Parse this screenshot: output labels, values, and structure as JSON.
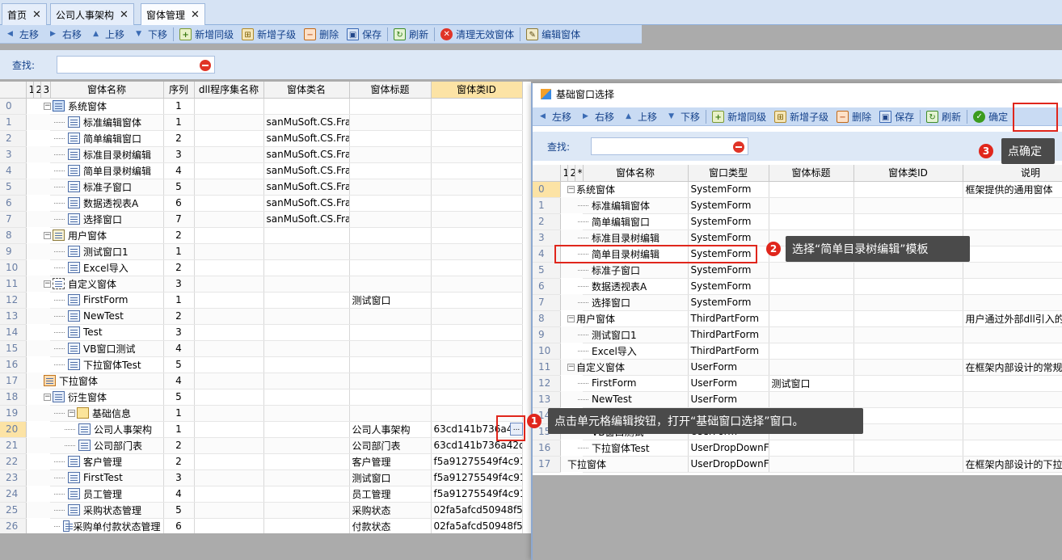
{
  "tabs": [
    {
      "label": "首页"
    },
    {
      "label": "公司人事架构"
    },
    {
      "label": "窗体管理",
      "active": true
    }
  ],
  "toolbar": {
    "left": "左移",
    "right": "右移",
    "up": "上移",
    "down": "下移",
    "add_sibling": "新增同级",
    "add_child": "新增子级",
    "delete": "删除",
    "save": "保存",
    "refresh": "刷新",
    "clear_invalid": "清理无效窗体",
    "edit_form": "编辑窗体"
  },
  "search": {
    "label": "查找:",
    "value": ""
  },
  "main_grid": {
    "headers": {
      "levels": [
        "1",
        "2",
        "3",
        "*"
      ],
      "name": "窗体名称",
      "seq": "序列",
      "dll": "dll程序集名称",
      "class": "窗体类名",
      "title": "窗体标题",
      "typeid": "窗体类ID"
    },
    "rows": [
      {
        "n": "0",
        "name": "系统窗体",
        "seq": "1",
        "cls": "",
        "title": "",
        "id": "",
        "lvl": 0,
        "icon": "sys",
        "exp": "⊟"
      },
      {
        "n": "1",
        "name": "标准编辑窗体",
        "seq": "1",
        "cls": "sanMuSoft.CS.Fra",
        "title": "",
        "id": "",
        "lvl": 1,
        "icon": "form"
      },
      {
        "n": "2",
        "name": "简单编辑窗口",
        "seq": "2",
        "cls": "sanMuSoft.CS.Fra",
        "title": "",
        "id": "",
        "lvl": 1,
        "icon": "form"
      },
      {
        "n": "3",
        "name": "标准目录树编辑",
        "seq": "3",
        "cls": "sanMuSoft.CS.Fra",
        "title": "",
        "id": "",
        "lvl": 1,
        "icon": "form"
      },
      {
        "n": "4",
        "name": "简单目录树编辑",
        "seq": "4",
        "cls": "sanMuSoft.CS.Fra",
        "title": "",
        "id": "",
        "lvl": 1,
        "icon": "form"
      },
      {
        "n": "5",
        "name": "标准子窗口",
        "seq": "5",
        "cls": "sanMuSoft.CS.Fra",
        "title": "",
        "id": "",
        "lvl": 1,
        "icon": "form"
      },
      {
        "n": "6",
        "name": "数据透视表A",
        "seq": "6",
        "cls": "sanMuSoft.CS.Fra",
        "title": "",
        "id": "",
        "lvl": 1,
        "icon": "form"
      },
      {
        "n": "7",
        "name": "选择窗口",
        "seq": "7",
        "cls": "sanMuSoft.CS.Fra",
        "title": "",
        "id": "",
        "lvl": 1,
        "icon": "form"
      },
      {
        "n": "8",
        "name": "用户窗体",
        "seq": "2",
        "cls": "",
        "title": "",
        "id": "",
        "lvl": 0,
        "icon": "usr",
        "exp": "⊟"
      },
      {
        "n": "9",
        "name": "测试窗口1",
        "seq": "1",
        "cls": "",
        "title": "",
        "id": "",
        "lvl": 1,
        "icon": "form"
      },
      {
        "n": "10",
        "name": "Excel导入",
        "seq": "2",
        "cls": "",
        "title": "",
        "id": "",
        "lvl": 1,
        "icon": "form"
      },
      {
        "n": "11",
        "name": "自定义窗体",
        "seq": "3",
        "cls": "",
        "title": "",
        "id": "",
        "lvl": 0,
        "icon": "custom",
        "exp": "⊟"
      },
      {
        "n": "12",
        "name": "FirstForm",
        "seq": "1",
        "cls": "",
        "title": "测试窗口",
        "id": "",
        "lvl": 1,
        "icon": "form"
      },
      {
        "n": "13",
        "name": "NewTest",
        "seq": "2",
        "cls": "",
        "title": "",
        "id": "",
        "lvl": 1,
        "icon": "form"
      },
      {
        "n": "14",
        "name": "Test",
        "seq": "3",
        "cls": "",
        "title": "",
        "id": "",
        "lvl": 1,
        "icon": "form"
      },
      {
        "n": "15",
        "name": "VB窗口测试",
        "seq": "4",
        "cls": "",
        "title": "",
        "id": "",
        "lvl": 1,
        "icon": "form"
      },
      {
        "n": "16",
        "name": "下拉窗体Test",
        "seq": "5",
        "cls": "",
        "title": "",
        "id": "",
        "lvl": 1,
        "icon": "form"
      },
      {
        "n": "17",
        "name": "下拉窗体",
        "seq": "4",
        "cls": "",
        "title": "",
        "id": "",
        "lvl": 0,
        "icon": "drop",
        "exp": ""
      },
      {
        "n": "18",
        "name": "衍生窗体",
        "seq": "5",
        "cls": "",
        "title": "",
        "id": "",
        "lvl": 0,
        "icon": "derive",
        "exp": "⊟"
      },
      {
        "n": "19",
        "name": "基础信息",
        "seq": "1",
        "cls": "",
        "title": "",
        "id": "",
        "lvl": 1,
        "icon": "folder",
        "exp": "⊟"
      },
      {
        "n": "20",
        "name": "公司人事架构",
        "seq": "1",
        "cls": "",
        "title": "公司人事架构",
        "id": "63cd141b736a4",
        "lvl": 2,
        "icon": "form",
        "selected": true
      },
      {
        "n": "21",
        "name": "公司部门表",
        "seq": "2",
        "cls": "",
        "title": "公司部门表",
        "id": "63cd141b736a42d",
        "lvl": 2,
        "icon": "form"
      },
      {
        "n": "22",
        "name": "客户管理",
        "seq": "2",
        "cls": "",
        "title": "客户管理",
        "id": "f5a91275549f4c91a",
        "lvl": 1,
        "icon": "form"
      },
      {
        "n": "23",
        "name": "FirstTest",
        "seq": "3",
        "cls": "",
        "title": "测试窗口",
        "id": "f5a91275549f4c91a",
        "lvl": 1,
        "icon": "form"
      },
      {
        "n": "24",
        "name": "员工管理",
        "seq": "4",
        "cls": "",
        "title": "员工管理",
        "id": "f5a91275549f4c91a",
        "lvl": 1,
        "icon": "form"
      },
      {
        "n": "25",
        "name": "采购状态管理",
        "seq": "5",
        "cls": "",
        "title": "采购状态",
        "id": "02fa5afcd50948f59",
        "lvl": 1,
        "icon": "form"
      },
      {
        "n": "26",
        "name": "采购单付款状态管理",
        "seq": "6",
        "cls": "",
        "title": "付款状态",
        "id": "02fa5afcd50948f59",
        "lvl": 1,
        "icon": "form"
      }
    ]
  },
  "dialog": {
    "title": "基础窗口选择",
    "toolbar": {
      "left": "左移",
      "right": "右移",
      "up": "上移",
      "down": "下移",
      "add_sibling": "新增同级",
      "add_child": "新增子级",
      "delete": "删除",
      "save": "保存",
      "refresh": "刷新",
      "ok": "确定"
    },
    "search_label": "查找:",
    "headers": {
      "levels": [
        "1",
        "2",
        "*"
      ],
      "name": "窗体名称",
      "wtype": "窗口类型",
      "title": "窗体标题",
      "typeid": "窗体类ID",
      "desc": "说明"
    },
    "rows": [
      {
        "n": "0",
        "name": "系统窗体",
        "wtype": "SystemForm",
        "title": "",
        "desc": "框架提供的通用窗体",
        "lvl": 0,
        "exp": "⊟"
      },
      {
        "n": "1",
        "name": "标准编辑窗体",
        "wtype": "SystemForm",
        "title": "",
        "desc": "",
        "lvl": 1
      },
      {
        "n": "2",
        "name": "简单编辑窗口",
        "wtype": "SystemForm",
        "title": "",
        "desc": "",
        "lvl": 1
      },
      {
        "n": "3",
        "name": "标准目录树编辑",
        "wtype": "SystemForm",
        "title": "",
        "desc": "",
        "lvl": 1
      },
      {
        "n": "4",
        "name": "简单目录树编辑",
        "wtype": "SystemForm",
        "title": "",
        "desc": "",
        "lvl": 1
      },
      {
        "n": "5",
        "name": "标准子窗口",
        "wtype": "SystemForm",
        "title": "",
        "desc": "",
        "lvl": 1
      },
      {
        "n": "6",
        "name": "数据透视表A",
        "wtype": "SystemForm",
        "title": "",
        "desc": "",
        "lvl": 1
      },
      {
        "n": "7",
        "name": "选择窗口",
        "wtype": "SystemForm",
        "title": "",
        "desc": "",
        "lvl": 1
      },
      {
        "n": "8",
        "name": "用户窗体",
        "wtype": "ThirdPartForm",
        "title": "",
        "desc": "用户通过外部dll引入的",
        "lvl": 0,
        "exp": "⊟"
      },
      {
        "n": "9",
        "name": "测试窗口1",
        "wtype": "ThirdPartForm",
        "title": "",
        "desc": "",
        "lvl": 1
      },
      {
        "n": "10",
        "name": "Excel导入",
        "wtype": "ThirdPartForm",
        "title": "",
        "desc": "",
        "lvl": 1
      },
      {
        "n": "11",
        "name": "自定义窗体",
        "wtype": "UserForm",
        "title": "",
        "desc": "在框架内部设计的常规",
        "lvl": 0,
        "exp": "⊟"
      },
      {
        "n": "12",
        "name": "FirstForm",
        "wtype": "UserForm",
        "title": "测试窗口",
        "desc": "",
        "lvl": 1
      },
      {
        "n": "13",
        "name": "NewTest",
        "wtype": "UserForm",
        "title": "",
        "desc": "",
        "lvl": 1
      },
      {
        "n": "14",
        "name": "Test",
        "wtype": "UserForm",
        "title": "",
        "desc": "",
        "lvl": 1
      },
      {
        "n": "15",
        "name": "VB窗口测试",
        "wtype": "UserForm",
        "title": "",
        "desc": "",
        "lvl": 1
      },
      {
        "n": "16",
        "name": "下拉窗体Test",
        "wtype": "UserDropDownF",
        "title": "",
        "desc": "",
        "lvl": 1
      },
      {
        "n": "17",
        "name": "下拉窗体",
        "wtype": "UserDropDownF",
        "title": "",
        "desc": "在框架内部设计的下拉",
        "lvl": 0,
        "exp": ""
      }
    ]
  },
  "callouts": {
    "c1": {
      "num": "1",
      "text": "点击单元格编辑按钮，打开“基础窗口选择”窗口。"
    },
    "c2": {
      "num": "2",
      "text": "选择“简单目录树编辑”模板"
    },
    "c3": {
      "num": "3",
      "text": "点确定"
    }
  },
  "edit_button_glyph": "..."
}
